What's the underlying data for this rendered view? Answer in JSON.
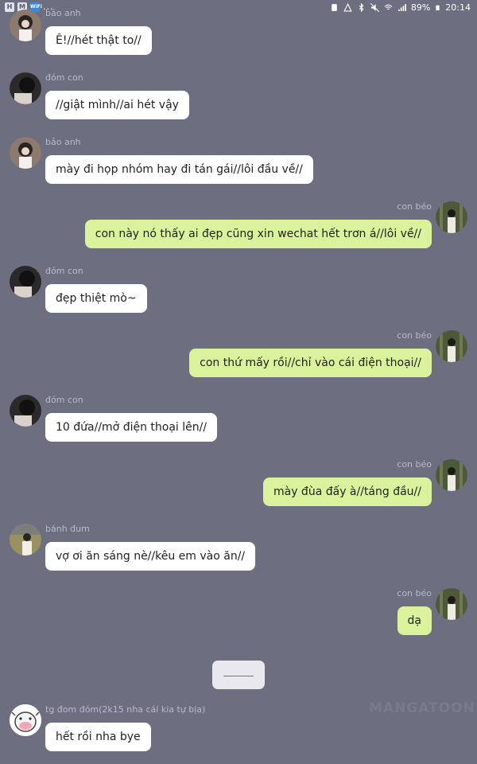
{
  "status_bar": {
    "battery": "89%",
    "time": "20:14",
    "left_icons": [
      "H",
      "M",
      "WiFi"
    ],
    "more": "..."
  },
  "messages": [
    {
      "side": "left",
      "sender": "bảo anh",
      "text": "Ê!//hét thật to//",
      "avatar": "girl-portrait-avatar"
    },
    {
      "side": "left",
      "sender": "đóm con",
      "text": "//giật mình//ai hét vậy",
      "avatar": "dark-hair-avatar"
    },
    {
      "side": "left",
      "sender": "bảo anh",
      "text": "mày đi họp nhóm hay đi tán gái//lôi đầu về//",
      "avatar": "girl-portrait-avatar"
    },
    {
      "side": "right",
      "sender": "con béo",
      "text": "con này nó thấy ai đẹp cũng xin wechat hết trơn á//lôi về//",
      "avatar": "forest-girl-avatar"
    },
    {
      "side": "left",
      "sender": "đóm con",
      "text": "đẹp thiệt mò~",
      "avatar": "dark-hair-avatar"
    },
    {
      "side": "right",
      "sender": "con béo",
      "text": "con thứ mấy rồi//chỉ vào cái điện thoại//",
      "avatar": "forest-girl-avatar"
    },
    {
      "side": "left",
      "sender": "đóm con",
      "text": "10 đứa//mở điện thoại lên//",
      "avatar": "dark-hair-avatar"
    },
    {
      "side": "right",
      "sender": "con béo",
      "text": "mày đùa đấy à//táng đầu//",
      "avatar": "forest-girl-avatar"
    },
    {
      "side": "left",
      "sender": "bánh đum",
      "text": "vợ ơi ăn sáng nè//kêu em vào ăn//",
      "avatar": "field-girl-avatar"
    },
    {
      "side": "right",
      "sender": "con béo",
      "text": "dạ",
      "avatar": "forest-girl-avatar"
    },
    {
      "side": "left",
      "sender": "tg đom đóm(2k15 nha cái kia tự bịa)",
      "text": "hết rồi nha bye",
      "avatar": "cow-avatar"
    }
  ],
  "watermark": "MANGATOON",
  "colors": {
    "background": "#6d6e80",
    "left_bubble": "#ffffff",
    "right_bubble": "#d9f29b",
    "name_text": "#b9bbc8"
  }
}
